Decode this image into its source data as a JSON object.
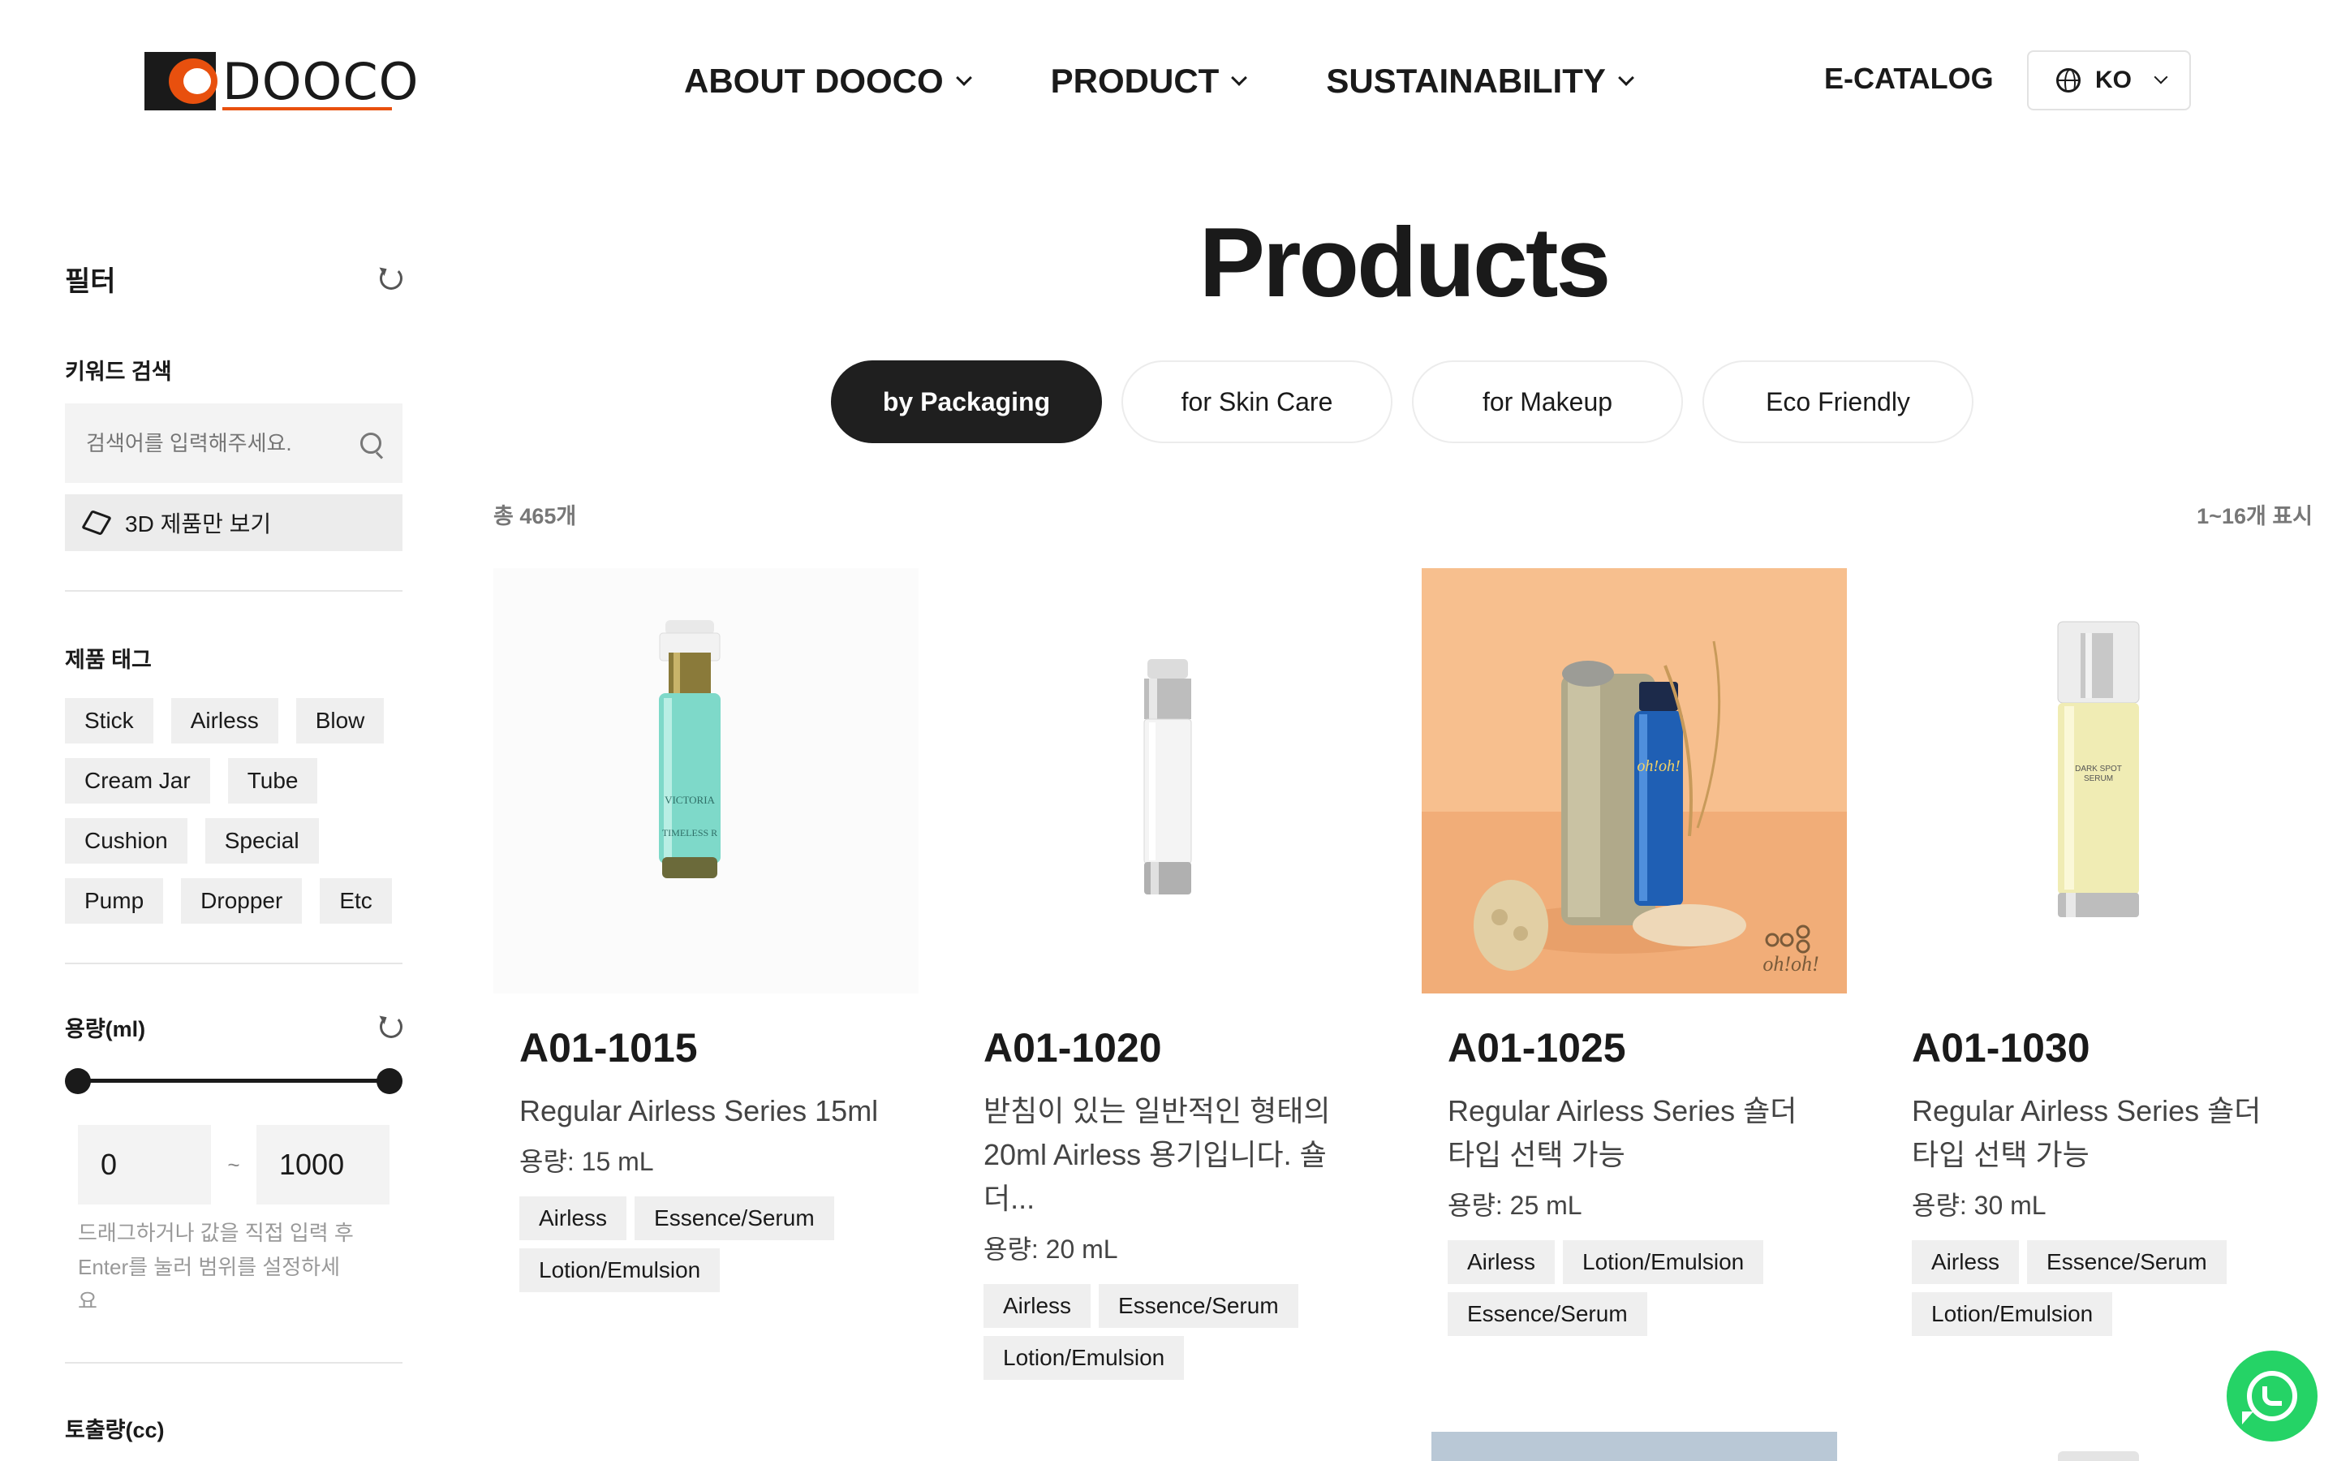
{
  "brand": {
    "logo_text": "DOOCO",
    "accent": "#e8500e"
  },
  "nav": {
    "items": [
      {
        "label": "ABOUT DOOCO"
      },
      {
        "label": "PRODUCT"
      },
      {
        "label": "SUSTAINABILITY"
      }
    ],
    "ecatalog": "E-CATALOG",
    "lang": "KO"
  },
  "sidebar": {
    "title": "필터",
    "keyword_label": "키워드 검색",
    "search_placeholder": "검색어를 입력해주세요.",
    "btn_3d": "3D 제품만 보기",
    "tag_label": "제품 태그",
    "tags": [
      "Stick",
      "Airless",
      "Blow",
      "Cream Jar",
      "Tube",
      "Cushion",
      "Special",
      "Pump",
      "Dropper",
      "Etc"
    ],
    "capacity_label": "용량(ml)",
    "capacity_min": "0",
    "capacity_max": "1000",
    "tilde": "~",
    "hint": "드래그하거나 값을 직접 입력 후 Enter를 눌러 범위를 설정하세요",
    "output_label": "토출량(cc)"
  },
  "main": {
    "title": "Products",
    "tabs": [
      "by Packaging",
      "for Skin Care",
      "for Makeup",
      "Eco Friendly"
    ],
    "active_tab": 0,
    "total": "총 465개",
    "showing": "1~16개 표시",
    "products": [
      {
        "code": "A01-1015",
        "desc": "Regular Airless Series 15ml",
        "capacity": "용량: 15 mL",
        "tags": [
          "Airless",
          "Essence/Serum",
          "Lotion/Emulsion"
        ]
      },
      {
        "code": "A01-1020",
        "desc": "받침이 있는 일반적인 형태의 20ml Airless 용기입니다. 숄더...",
        "capacity": "용량: 20 mL",
        "tags": [
          "Airless",
          "Essence/Serum",
          "Lotion/Emulsion"
        ]
      },
      {
        "code": "A01-1025",
        "desc": "Regular Airless Series 숄더 타입 선택 가능",
        "capacity": "용량: 25 mL",
        "tags": [
          "Airless",
          "Lotion/Emulsion",
          "Essence/Serum"
        ]
      },
      {
        "code": "A01-1030",
        "desc": "Regular Airless Series 숄더 타입 선택 가능",
        "capacity": "용량: 30 mL",
        "tags": [
          "Airless",
          "Essence/Serum",
          "Lotion/Emulsion"
        ]
      }
    ]
  }
}
